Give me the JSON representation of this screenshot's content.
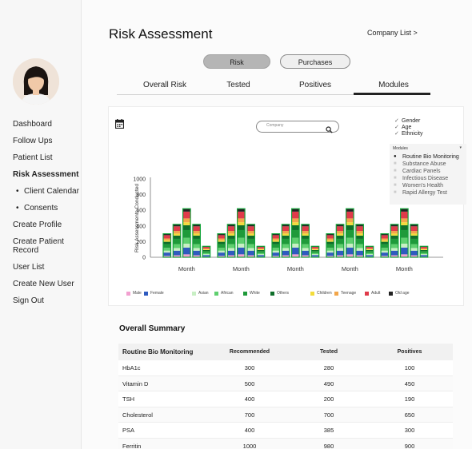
{
  "sidebar": {
    "items": [
      {
        "label": "Dashboard"
      },
      {
        "label": "Follow Ups"
      },
      {
        "label": "Patient List"
      },
      {
        "label": "Risk Assessment"
      },
      {
        "label": "Client Calendar"
      },
      {
        "label": "Consents"
      },
      {
        "label": "Create Profile"
      },
      {
        "label": "Create Patient Record"
      },
      {
        "label": "User List"
      },
      {
        "label": "Create New User"
      },
      {
        "label": "Sign Out"
      }
    ]
  },
  "header": {
    "title": "Risk Assessment",
    "company_link": "Company List >"
  },
  "toggle": {
    "risk": "Risk",
    "purchases": "Purchases"
  },
  "tabs": [
    "Overall Risk",
    "Tested",
    "Positives",
    "Modules"
  ],
  "search": {
    "placeholder": "Company"
  },
  "filters": [
    "Gender",
    "Age",
    "Ethnicity"
  ],
  "modules": {
    "label": "Modules",
    "items": [
      "Routine Bio Monitoring",
      "Substance Abuse",
      "Cardiac Panels",
      "Infectious Disease",
      "Women's Health",
      "Rapid Allergy Test"
    ],
    "selected": "Routine Bio Monitoring"
  },
  "colors": {
    "male": "#f2a0d0",
    "female": "#2f5bbf",
    "asian": "#c8efc4",
    "african": "#5fcf6f",
    "white": "#1f9a3a",
    "others": "#0f6e2a",
    "children": "#f3dc3a",
    "teenage": "#f2a64a",
    "adult": "#e03a4a",
    "old_age": "#222222",
    "bar_outline": "#14a33a"
  },
  "legend": [
    "Male",
    "Female",
    "Asian",
    "African",
    "White",
    "Others",
    "Children",
    "Teenage",
    "Adult",
    "Old age"
  ],
  "chart_data": {
    "type": "bar",
    "ylabel": "Risk Assessments Conducted",
    "xlabel": "",
    "ylim": [
      0,
      1000
    ],
    "yticks": [
      0,
      200,
      400,
      600,
      800,
      1000
    ],
    "categories": [
      "Month",
      "Month",
      "Month",
      "Month",
      "Month"
    ],
    "bars_per_group": [
      300,
      420,
      620,
      420,
      140
    ],
    "grid": false
  },
  "summary": {
    "title": "Overall Summary",
    "columns": [
      "Routine Bio Monitoring",
      "Recommended",
      "Tested",
      "Positives"
    ],
    "rows": [
      [
        "HbA1c",
        "300",
        "280",
        "100"
      ],
      [
        "Vitamin D",
        "500",
        "490",
        "450"
      ],
      [
        "TSH",
        "400",
        "200",
        "190"
      ],
      [
        "Cholesterol",
        "700",
        "700",
        "650"
      ],
      [
        "PSA",
        "400",
        "385",
        "300"
      ],
      [
        "Ferritin",
        "1000",
        "980",
        "900"
      ]
    ]
  }
}
